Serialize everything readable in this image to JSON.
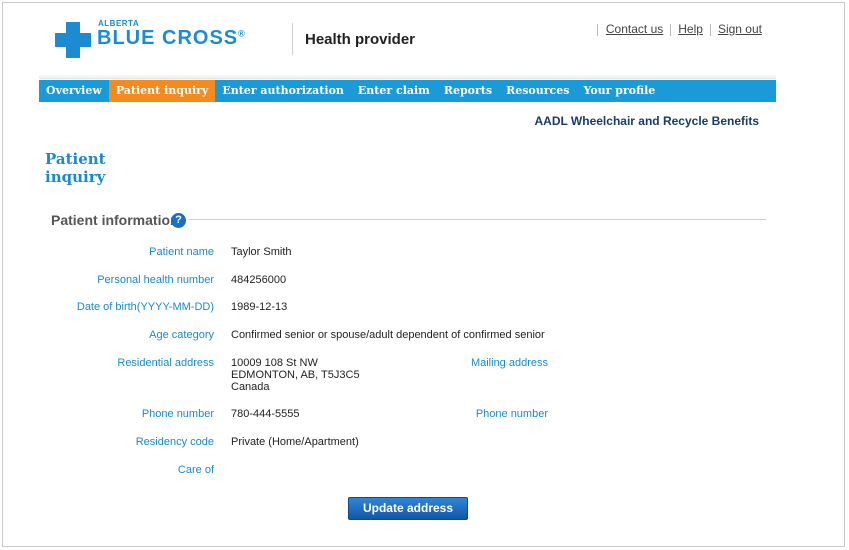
{
  "header": {
    "brand_small": "ALBERTA",
    "brand_big": "BLUE CROSS",
    "brand_mark": "®",
    "portal_title": "Health provider",
    "links": [
      "Contact us",
      "Help",
      "Sign out"
    ]
  },
  "nav": {
    "items": [
      "Overview",
      "Patient inquiry",
      "Enter authorization",
      "Enter claim",
      "Reports",
      "Resources",
      "Your profile"
    ],
    "active": "Patient inquiry"
  },
  "subtitle": "AADL Wheelchair and Recycle Benefits",
  "page_heading": "Patient inquiry",
  "section": {
    "title": "Patient information",
    "help_glyph": "?"
  },
  "patient": {
    "name_label": "Patient name",
    "name": "Taylor Smith",
    "phn_label": "Personal health number",
    "phn": "484256000",
    "dob_label": "Date of birth(YYYY-MM-DD)",
    "dob": "1989-12-13",
    "age_label": "Age category",
    "age": "Confirmed senior or spouse/adult dependent of confirmed senior",
    "res_addr_label": "Residential address",
    "res_addr_line1": "10009 108 St NW",
    "res_addr_line2": "EDMONTON, AB, T5J3C5",
    "res_addr_line3": "Canada",
    "mail_addr_label": "Mailing address",
    "phone_label": "Phone number",
    "phone": "780-444-5555",
    "mail_phone_label": "Phone number",
    "residency_label": "Residency code",
    "residency": "Private (Home/Apartment)",
    "careof_label": "Care of"
  },
  "actions": {
    "update_address": "Update address"
  },
  "colors": {
    "brand_blue": "#1d8bd0",
    "nav_blue": "#1a9bd7",
    "nav_active": "#f38b1f",
    "label_blue": "#1a8ac9"
  },
  "icons": {
    "logo": "blue-cross-icon",
    "help": "help-icon"
  }
}
